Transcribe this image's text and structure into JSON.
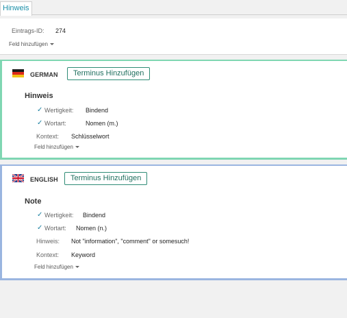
{
  "tabs": [
    {
      "label": "Hinweis"
    }
  ],
  "entry": {
    "id_label": "Eintrags-ID:",
    "id_value": "274",
    "add_field_label": "Feld hinzufügen"
  },
  "languages": [
    {
      "code": "de",
      "name": "GERMAN",
      "flag_icon": "germany-flag-icon",
      "accent": "#7fd6b2",
      "add_term_label": "Terminus Hinzufügen",
      "term": "Hinweis",
      "fields": [
        {
          "label": "Wertigkeit:",
          "value": "Bindend",
          "checked": true
        },
        {
          "label": "Wortart:",
          "value": "Nomen (m.)",
          "checked": true
        },
        {
          "label": "Kontext:",
          "value": "Schlüsselwort",
          "checked": false
        }
      ],
      "add_field_label": "Feld hinzufügen"
    },
    {
      "code": "en",
      "name": "ENGLISH",
      "flag_icon": "uk-flag-icon",
      "accent": "#9ab5e0",
      "add_term_label": "Terminus Hinzufügen",
      "term": "Note",
      "fields": [
        {
          "label": "Wertigkeit:",
          "value": "Bindend",
          "checked": true
        },
        {
          "label": "Wortart:",
          "value": "Nomen (n.)",
          "checked": true
        },
        {
          "label": "Hinweis:",
          "value": "Not \"information\", \"comment\" or somesuch!",
          "checked": false
        },
        {
          "label": "Kontext:",
          "value": "Keyword",
          "checked": false
        }
      ],
      "add_field_label": "Feld hinzufügen"
    }
  ],
  "check_icon": "checkmark-icon",
  "caret_icon": "caret-down-icon"
}
